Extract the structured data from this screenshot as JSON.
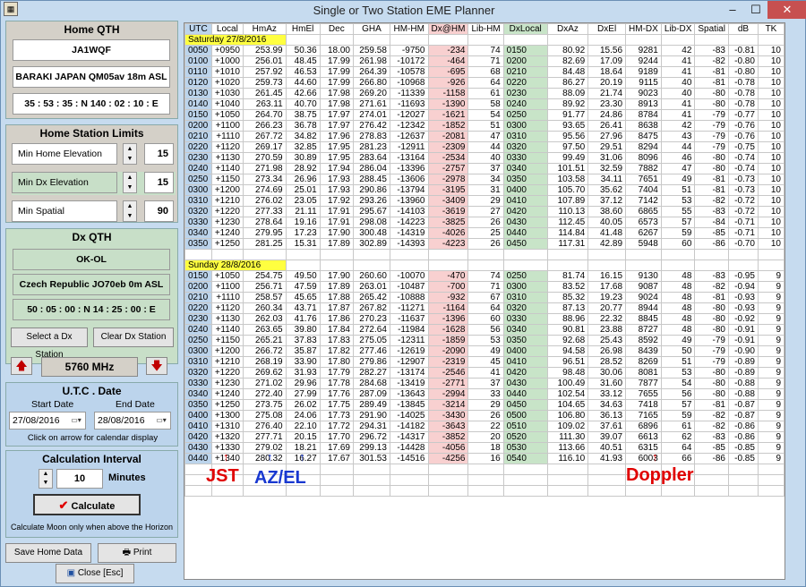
{
  "window": {
    "title": "Single or Two Station EME Planner"
  },
  "home": {
    "header": "Home  QTH",
    "call": "JA1WQF",
    "location": "BARAKI JAPAN  QM05av  18m ASL",
    "coords": "35 : 53 : 35 : N   140 : 02 : 10 : E"
  },
  "limits": {
    "header": "Home Station Limits",
    "items": [
      {
        "label": "Min Home Elevation",
        "value": "15"
      },
      {
        "label": "Min  Dx  Elevation",
        "value": "15"
      },
      {
        "label": "Min Spatial",
        "value": "90"
      }
    ]
  },
  "dx": {
    "header": "Dx  QTH",
    "call": "OK-OL",
    "location": "Czech Republic  JO70eb  0m ASL",
    "coords": "50 : 05 : 00 : N   14 : 25 : 00 : E",
    "select_label": "Select a Dx Station",
    "clear_label": "Clear Dx Station"
  },
  "freq": {
    "value": "5760 MHz"
  },
  "utc": {
    "header": "U.T.C . Date",
    "start_label": "Start Date",
    "end_label": "End Date",
    "start": "27/08/2016",
    "end": "28/08/2016",
    "hint": "Click on arrow for calendar display"
  },
  "calc": {
    "header": "Calculation Interval",
    "interval": "10",
    "unit": "Minutes",
    "button": "Calculate",
    "note": "Calculate Moon only when above the Horizon"
  },
  "buttons": {
    "save": "Save Home Data",
    "print": "Print",
    "close": "Close [Esc]"
  },
  "annotations": {
    "jst": "JST",
    "azel": "AZ/EL",
    "doppler": "Doppler"
  },
  "colors": {
    "annot_red": "#e00000",
    "annot_blue": "#1838d0",
    "date_bg": "#ffff40",
    "utc_bg": "#bcd4ec",
    "red_bg": "#f8d0d0",
    "green_bg": "#c8e4c8"
  },
  "columns": [
    "UTC",
    "Local",
    "HmAz",
    "HmEl",
    "Dec",
    "GHA",
    "HM-HM",
    "Dx@HM",
    "Lib-HM",
    "DxLocal",
    "DxAz",
    "DxEl",
    "HM-DX",
    "Lib-DX",
    "Spatial",
    "dB",
    "TK"
  ],
  "sections": [
    {
      "date": "Saturday 27/8/2016",
      "rows": [
        [
          "0050",
          "+0950",
          "253.99",
          "50.36",
          "18.00",
          "259.58",
          "-9750",
          "-234",
          "74",
          "0150",
          "80.92",
          "15.56",
          "9281",
          "42",
          "-83",
          "-0.81",
          "10"
        ],
        [
          "0100",
          "+1000",
          "256.01",
          "48.45",
          "17.99",
          "261.98",
          "-10172",
          "-464",
          "71",
          "0200",
          "82.69",
          "17.09",
          "9244",
          "41",
          "-82",
          "-0.80",
          "10"
        ],
        [
          "0110",
          "+1010",
          "257.92",
          "46.53",
          "17.99",
          "264.39",
          "-10578",
          "-695",
          "68",
          "0210",
          "84.48",
          "18.64",
          "9189",
          "41",
          "-81",
          "-0.80",
          "10"
        ],
        [
          "0120",
          "+1020",
          "259.73",
          "44.60",
          "17.99",
          "266.80",
          "-10968",
          "-926",
          "64",
          "0220",
          "86.27",
          "20.19",
          "9115",
          "40",
          "-81",
          "-0.78",
          "10"
        ],
        [
          "0130",
          "+1030",
          "261.45",
          "42.66",
          "17.98",
          "269.20",
          "-11339",
          "-1158",
          "61",
          "0230",
          "88.09",
          "21.74",
          "9023",
          "40",
          "-80",
          "-0.78",
          "10"
        ],
        [
          "0140",
          "+1040",
          "263.11",
          "40.70",
          "17.98",
          "271.61",
          "-11693",
          "-1390",
          "58",
          "0240",
          "89.92",
          "23.30",
          "8913",
          "41",
          "-80",
          "-0.78",
          "10"
        ],
        [
          "0150",
          "+1050",
          "264.70",
          "38.75",
          "17.97",
          "274.01",
          "-12027",
          "-1621",
          "54",
          "0250",
          "91.77",
          "24.86",
          "8784",
          "41",
          "-79",
          "-0.77",
          "10"
        ],
        [
          "0200",
          "+1100",
          "266.23",
          "36.78",
          "17.97",
          "276.42",
          "-12342",
          "-1852",
          "51",
          "0300",
          "93.65",
          "26.41",
          "8638",
          "42",
          "-79",
          "-0.76",
          "10"
        ],
        [
          "0210",
          "+1110",
          "267.72",
          "34.82",
          "17.96",
          "278.83",
          "-12637",
          "-2081",
          "47",
          "0310",
          "95.56",
          "27.96",
          "8475",
          "43",
          "-79",
          "-0.76",
          "10"
        ],
        [
          "0220",
          "+1120",
          "269.17",
          "32.85",
          "17.95",
          "281.23",
          "-12911",
          "-2309",
          "44",
          "0320",
          "97.50",
          "29.51",
          "8294",
          "44",
          "-79",
          "-0.75",
          "10"
        ],
        [
          "0230",
          "+1130",
          "270.59",
          "30.89",
          "17.95",
          "283.64",
          "-13164",
          "-2534",
          "40",
          "0330",
          "99.49",
          "31.06",
          "8096",
          "46",
          "-80",
          "-0.74",
          "10"
        ],
        [
          "0240",
          "+1140",
          "271.98",
          "28.92",
          "17.94",
          "286.04",
          "-13396",
          "-2757",
          "37",
          "0340",
          "101.51",
          "32.59",
          "7882",
          "47",
          "-80",
          "-0.74",
          "10"
        ],
        [
          "0250",
          "+1150",
          "273.34",
          "26.96",
          "17.93",
          "288.45",
          "-13606",
          "-2978",
          "34",
          "0350",
          "103.58",
          "34.11",
          "7651",
          "49",
          "-81",
          "-0.73",
          "10"
        ],
        [
          "0300",
          "+1200",
          "274.69",
          "25.01",
          "17.93",
          "290.86",
          "-13794",
          "-3195",
          "31",
          "0400",
          "105.70",
          "35.62",
          "7404",
          "51",
          "-81",
          "-0.73",
          "10"
        ],
        [
          "0310",
          "+1210",
          "276.02",
          "23.05",
          "17.92",
          "293.26",
          "-13960",
          "-3409",
          "29",
          "0410",
          "107.89",
          "37.12",
          "7142",
          "53",
          "-82",
          "-0.72",
          "10"
        ],
        [
          "0320",
          "+1220",
          "277.33",
          "21.11",
          "17.91",
          "295.67",
          "-14103",
          "-3619",
          "27",
          "0420",
          "110.13",
          "38.60",
          "6865",
          "55",
          "-83",
          "-0.72",
          "10"
        ],
        [
          "0330",
          "+1230",
          "278.64",
          "19.16",
          "17.91",
          "298.08",
          "-14223",
          "-3825",
          "26",
          "0430",
          "112.45",
          "40.05",
          "6573",
          "57",
          "-84",
          "-0.71",
          "10"
        ],
        [
          "0340",
          "+1240",
          "279.95",
          "17.23",
          "17.90",
          "300.48",
          "-14319",
          "-4026",
          "25",
          "0440",
          "114.84",
          "41.48",
          "6267",
          "59",
          "-85",
          "-0.71",
          "10"
        ],
        [
          "0350",
          "+1250",
          "281.25",
          "15.31",
          "17.89",
          "302.89",
          "-14393",
          "-4223",
          "26",
          "0450",
          "117.31",
          "42.89",
          "5948",
          "60",
          "-86",
          "-0.70",
          "10"
        ]
      ]
    },
    {
      "date": "Sunday 28/8/2016",
      "rows": [
        [
          "0150",
          "+1050",
          "254.75",
          "49.50",
          "17.90",
          "260.60",
          "-10070",
          "-470",
          "74",
          "0250",
          "81.74",
          "16.15",
          "9130",
          "48",
          "-83",
          "-0.95",
          "9"
        ],
        [
          "0200",
          "+1100",
          "256.71",
          "47.59",
          "17.89",
          "263.01",
          "-10487",
          "-700",
          "71",
          "0300",
          "83.52",
          "17.68",
          "9087",
          "48",
          "-82",
          "-0.94",
          "9"
        ],
        [
          "0210",
          "+1110",
          "258.57",
          "45.65",
          "17.88",
          "265.42",
          "-10888",
          "-932",
          "67",
          "0310",
          "85.32",
          "19.23",
          "9024",
          "48",
          "-81",
          "-0.93",
          "9"
        ],
        [
          "0220",
          "+1120",
          "260.34",
          "43.71",
          "17.87",
          "267.82",
          "-11271",
          "-1164",
          "64",
          "0320",
          "87.13",
          "20.77",
          "8944",
          "48",
          "-80",
          "-0.93",
          "9"
        ],
        [
          "0230",
          "+1130",
          "262.03",
          "41.76",
          "17.86",
          "270.23",
          "-11637",
          "-1396",
          "60",
          "0330",
          "88.96",
          "22.32",
          "8845",
          "48",
          "-80",
          "-0.92",
          "9"
        ],
        [
          "0240",
          "+1140",
          "263.65",
          "39.80",
          "17.84",
          "272.64",
          "-11984",
          "-1628",
          "56",
          "0340",
          "90.81",
          "23.88",
          "8727",
          "48",
          "-80",
          "-0.91",
          "9"
        ],
        [
          "0250",
          "+1150",
          "265.21",
          "37.83",
          "17.83",
          "275.05",
          "-12311",
          "-1859",
          "53",
          "0350",
          "92.68",
          "25.43",
          "8592",
          "49",
          "-79",
          "-0.91",
          "9"
        ],
        [
          "0300",
          "+1200",
          "266.72",
          "35.87",
          "17.82",
          "277.46",
          "-12619",
          "-2090",
          "49",
          "0400",
          "94.58",
          "26.98",
          "8439",
          "50",
          "-79",
          "-0.90",
          "9"
        ],
        [
          "0310",
          "+1210",
          "268.19",
          "33.90",
          "17.80",
          "279.86",
          "-12907",
          "-2319",
          "45",
          "0410",
          "96.51",
          "28.52",
          "8269",
          "51",
          "-79",
          "-0.89",
          "9"
        ],
        [
          "0320",
          "+1220",
          "269.62",
          "31.93",
          "17.79",
          "282.27",
          "-13174",
          "-2546",
          "41",
          "0420",
          "98.48",
          "30.06",
          "8081",
          "53",
          "-80",
          "-0.89",
          "9"
        ],
        [
          "0330",
          "+1230",
          "271.02",
          "29.96",
          "17.78",
          "284.68",
          "-13419",
          "-2771",
          "37",
          "0430",
          "100.49",
          "31.60",
          "7877",
          "54",
          "-80",
          "-0.88",
          "9"
        ],
        [
          "0340",
          "+1240",
          "272.40",
          "27.99",
          "17.76",
          "287.09",
          "-13643",
          "-2994",
          "33",
          "0440",
          "102.54",
          "33.12",
          "7655",
          "56",
          "-80",
          "-0.88",
          "9"
        ],
        [
          "0350",
          "+1250",
          "273.75",
          "26.02",
          "17.75",
          "289.49",
          "-13845",
          "-3214",
          "29",
          "0450",
          "104.65",
          "34.63",
          "7418",
          "57",
          "-81",
          "-0.87",
          "9"
        ],
        [
          "0400",
          "+1300",
          "275.08",
          "24.06",
          "17.73",
          "291.90",
          "-14025",
          "-3430",
          "26",
          "0500",
          "106.80",
          "36.13",
          "7165",
          "59",
          "-82",
          "-0.87",
          "9"
        ],
        [
          "0410",
          "+1310",
          "276.40",
          "22.10",
          "17.72",
          "294.31",
          "-14182",
          "-3643",
          "22",
          "0510",
          "109.02",
          "37.61",
          "6896",
          "61",
          "-82",
          "-0.86",
          "9"
        ],
        [
          "0420",
          "+1320",
          "277.71",
          "20.15",
          "17.70",
          "296.72",
          "-14317",
          "-3852",
          "20",
          "0520",
          "111.30",
          "39.07",
          "6613",
          "62",
          "-83",
          "-0.86",
          "9"
        ],
        [
          "0430",
          "+1330",
          "279.02",
          "18.21",
          "17.69",
          "299.13",
          "-14428",
          "-4056",
          "18",
          "0530",
          "113.66",
          "40.51",
          "6315",
          "64",
          "-85",
          "-0.85",
          "9"
        ],
        [
          "0440",
          "+1340",
          "280.32",
          "16.27",
          "17.67",
          "301.53",
          "-14516",
          "-4256",
          "16",
          "0540",
          "116.10",
          "41.93",
          "6003",
          "66",
          "-86",
          "-0.85",
          "9"
        ]
      ]
    }
  ]
}
